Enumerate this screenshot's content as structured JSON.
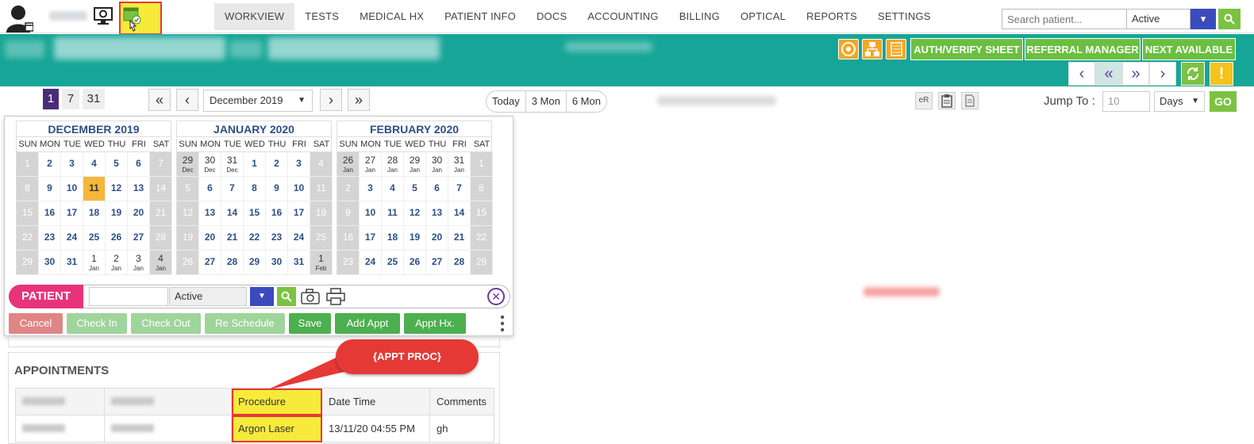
{
  "nav": {
    "items": [
      "WORKVIEW",
      "TESTS",
      "MEDICAL HX",
      "PATIENT INFO",
      "DOCS",
      "ACCOUNTING",
      "BILLING",
      "OPTICAL",
      "REPORTS",
      "SETTINGS"
    ],
    "active": "WORKVIEW"
  },
  "search": {
    "placeholder": "Search patient...",
    "status": "Active"
  },
  "header_buttons": {
    "auth": "AUTH/VERIFY SHEET",
    "referral": "REFERRAL MANAGER",
    "next": "NEXT AVAILABLE"
  },
  "toolbar": {
    "views": [
      "1",
      "7",
      "31"
    ],
    "month": "December 2019",
    "ranges": [
      "Today",
      "3 Mon",
      "6 Mon"
    ],
    "er_label": "eR",
    "jump_label": "Jump To :",
    "jump_value": "10",
    "jump_unit": "Days",
    "go": "GO"
  },
  "calendar": {
    "weekdays": [
      "SUN",
      "MON",
      "TUE",
      "WED",
      "THU",
      "FRI",
      "SAT"
    ],
    "months": [
      {
        "title": "DECEMBER 2019",
        "weeks": [
          [
            [
              "1",
              ""
            ],
            [
              "2",
              ""
            ],
            [
              "3",
              ""
            ],
            [
              "4",
              ""
            ],
            [
              "5",
              ""
            ],
            [
              "6",
              ""
            ],
            [
              "7",
              ""
            ]
          ],
          [
            [
              "8",
              ""
            ],
            [
              "9",
              ""
            ],
            [
              "10",
              ""
            ],
            [
              "11",
              ""
            ],
            [
              "12",
              ""
            ],
            [
              "13",
              ""
            ],
            [
              "14",
              ""
            ]
          ],
          [
            [
              "15",
              ""
            ],
            [
              "16",
              ""
            ],
            [
              "17",
              ""
            ],
            [
              "18",
              ""
            ],
            [
              "19",
              ""
            ],
            [
              "20",
              ""
            ],
            [
              "21",
              ""
            ]
          ],
          [
            [
              "22",
              ""
            ],
            [
              "23",
              ""
            ],
            [
              "24",
              ""
            ],
            [
              "25",
              ""
            ],
            [
              "26",
              ""
            ],
            [
              "27",
              ""
            ],
            [
              "28",
              ""
            ]
          ],
          [
            [
              "29",
              ""
            ],
            [
              "30",
              ""
            ],
            [
              "31",
              ""
            ],
            [
              "1",
              "Jan"
            ],
            [
              "2",
              "Jan"
            ],
            [
              "3",
              "Jan"
            ],
            [
              "4",
              "Jan"
            ]
          ]
        ],
        "today": "11"
      },
      {
        "title": "JANUARY 2020",
        "weeks": [
          [
            [
              "29",
              "Dec"
            ],
            [
              "30",
              "Dec"
            ],
            [
              "31",
              "Dec"
            ],
            [
              "1",
              ""
            ],
            [
              "2",
              ""
            ],
            [
              "3",
              ""
            ],
            [
              "4",
              ""
            ]
          ],
          [
            [
              "5",
              ""
            ],
            [
              "6",
              ""
            ],
            [
              "7",
              ""
            ],
            [
              "8",
              ""
            ],
            [
              "9",
              ""
            ],
            [
              "10",
              ""
            ],
            [
              "11",
              ""
            ]
          ],
          [
            [
              "12",
              ""
            ],
            [
              "13",
              ""
            ],
            [
              "14",
              ""
            ],
            [
              "15",
              ""
            ],
            [
              "16",
              ""
            ],
            [
              "17",
              ""
            ],
            [
              "18",
              ""
            ]
          ],
          [
            [
              "19",
              ""
            ],
            [
              "20",
              ""
            ],
            [
              "21",
              ""
            ],
            [
              "22",
              ""
            ],
            [
              "23",
              ""
            ],
            [
              "24",
              ""
            ],
            [
              "25",
              ""
            ]
          ],
          [
            [
              "26",
              ""
            ],
            [
              "27",
              ""
            ],
            [
              "28",
              ""
            ],
            [
              "29",
              ""
            ],
            [
              "30",
              ""
            ],
            [
              "31",
              ""
            ],
            [
              "1",
              "Feb"
            ]
          ]
        ],
        "today": ""
      },
      {
        "title": "FEBRUARY 2020",
        "weeks": [
          [
            [
              "26",
              "Jan"
            ],
            [
              "27",
              "Jan"
            ],
            [
              "28",
              "Jan"
            ],
            [
              "29",
              "Jan"
            ],
            [
              "30",
              "Jan"
            ],
            [
              "31",
              "Jan"
            ],
            [
              "1",
              ""
            ]
          ],
          [
            [
              "2",
              ""
            ],
            [
              "3",
              ""
            ],
            [
              "4",
              ""
            ],
            [
              "5",
              ""
            ],
            [
              "6",
              ""
            ],
            [
              "7",
              ""
            ],
            [
              "8",
              ""
            ]
          ],
          [
            [
              "9",
              ""
            ],
            [
              "10",
              ""
            ],
            [
              "11",
              ""
            ],
            [
              "12",
              ""
            ],
            [
              "13",
              ""
            ],
            [
              "14",
              ""
            ],
            [
              "15",
              ""
            ]
          ],
          [
            [
              "16",
              ""
            ],
            [
              "17",
              ""
            ],
            [
              "18",
              ""
            ],
            [
              "19",
              ""
            ],
            [
              "20",
              ""
            ],
            [
              "21",
              ""
            ],
            [
              "22",
              ""
            ]
          ],
          [
            [
              "23",
              ""
            ],
            [
              "24",
              ""
            ],
            [
              "25",
              ""
            ],
            [
              "26",
              ""
            ],
            [
              "27",
              ""
            ],
            [
              "28",
              ""
            ],
            [
              "29",
              ""
            ]
          ]
        ],
        "today": ""
      }
    ]
  },
  "patient_bar": {
    "label": "PATIENT",
    "input_value": "",
    "status": "Active"
  },
  "actions": [
    "Cancel",
    "Check In",
    "Check Out",
    "Re Schedule",
    "Save",
    "Add Appt",
    "Appt Hx."
  ],
  "appointments": {
    "title": "APPOINTMENTS",
    "columns": [
      "",
      "",
      "Procedure",
      "Date Time",
      "Comments"
    ],
    "rows": [
      [
        "",
        "",
        "Argon Laser",
        "13/11/20 04:55 PM",
        "gh"
      ]
    ]
  },
  "callout": "{APPT PROC}",
  "colors": {
    "teal": "#17a597",
    "green": "#6abf40",
    "blue": "#3b4bbd",
    "pink": "#e8337a",
    "highlight": "#f7ea3a",
    "red": "#e53935"
  }
}
